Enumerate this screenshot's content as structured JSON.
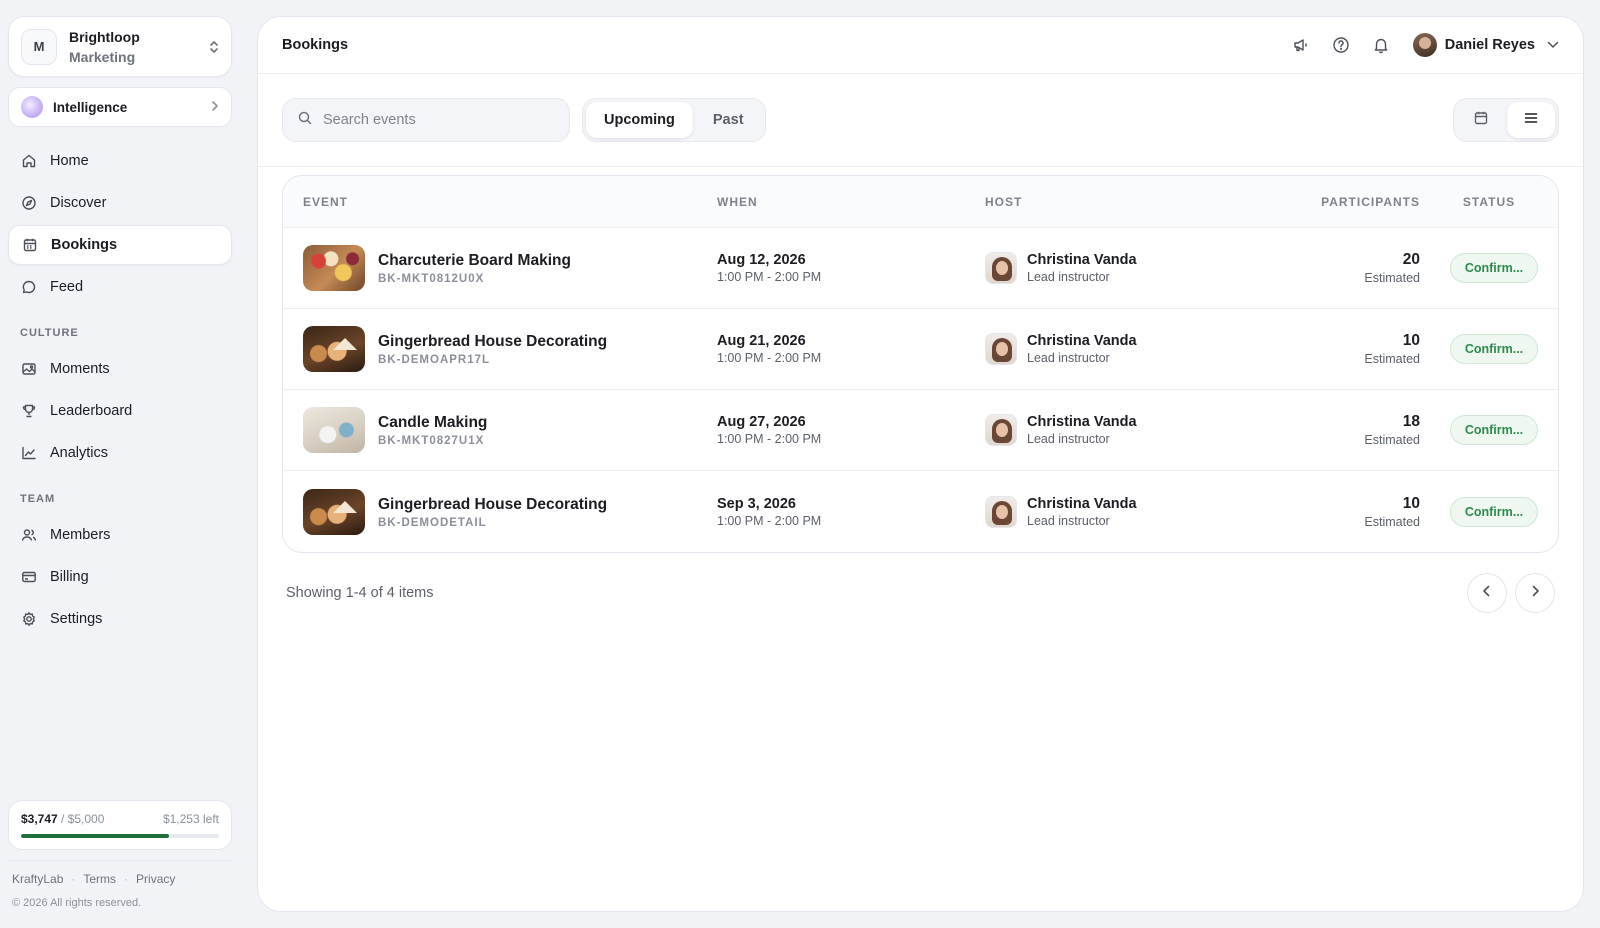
{
  "org": {
    "initial": "M",
    "name": "Brightloop",
    "sub": "Marketing"
  },
  "intelligence": {
    "label": "Intelligence"
  },
  "nav": {
    "main": [
      {
        "label": "Home",
        "icon": "home-icon"
      },
      {
        "label": "Discover",
        "icon": "compass-icon"
      },
      {
        "label": "Bookings",
        "icon": "calendar-icon",
        "active": true
      },
      {
        "label": "Feed",
        "icon": "chat-bubble-icon"
      }
    ],
    "culture_title": "CULTURE",
    "culture": [
      {
        "label": "Moments",
        "icon": "images-icon"
      },
      {
        "label": "Leaderboard",
        "icon": "trophy-icon"
      },
      {
        "label": "Analytics",
        "icon": "line-chart-icon"
      }
    ],
    "team_title": "TEAM",
    "team": [
      {
        "label": "Members",
        "icon": "users-icon"
      },
      {
        "label": "Billing",
        "icon": "credit-card-icon"
      },
      {
        "label": "Settings",
        "icon": "gear-icon"
      }
    ]
  },
  "budget": {
    "spent": "$3,747",
    "total": " / $5,000",
    "left": "$1,253 left",
    "fraction": 0.7494
  },
  "footer": {
    "brand": "KraftyLab",
    "terms": "Terms",
    "privacy": "Privacy",
    "copyright": "© 2026 All rights reserved."
  },
  "header": {
    "title": "Bookings",
    "user_name": "Daniel Reyes"
  },
  "toolbar": {
    "search_placeholder": "Search events",
    "tabs": [
      {
        "label": "Upcoming",
        "active": true
      },
      {
        "label": "Past"
      }
    ]
  },
  "table": {
    "columns": [
      "EVENT",
      "WHEN",
      "HOST",
      "PARTICIPANTS",
      "STATUS"
    ],
    "rows": [
      {
        "name": "Charcuterie Board Making",
        "code": "BK-MKT0812U0X",
        "date": "Aug 12, 2026",
        "time": "1:00 PM - 2:00 PM",
        "host": "Christina Vanda",
        "role": "Lead instructor",
        "participants": "20",
        "participants_label": "Estimated",
        "status": "Confirm...",
        "thumb": "charcuterie"
      },
      {
        "name": "Gingerbread House Decorating",
        "code": "BK-DEMOAPR17L",
        "date": "Aug 21, 2026",
        "time": "1:00 PM - 2:00 PM",
        "host": "Christina Vanda",
        "role": "Lead instructor",
        "participants": "10",
        "participants_label": "Estimated",
        "status": "Confirm...",
        "thumb": "gingerbread"
      },
      {
        "name": "Candle Making",
        "code": "BK-MKT0827U1X",
        "date": "Aug 27, 2026",
        "time": "1:00 PM - 2:00 PM",
        "host": "Christina Vanda",
        "role": "Lead instructor",
        "participants": "18",
        "participants_label": "Estimated",
        "status": "Confirm...",
        "thumb": "candle"
      },
      {
        "name": "Gingerbread House Decorating",
        "code": "BK-DEMODETAIL",
        "date": "Sep 3, 2026",
        "time": "1:00 PM - 2:00 PM",
        "host": "Christina Vanda",
        "role": "Lead instructor",
        "participants": "10",
        "participants_label": "Estimated",
        "status": "Confirm...",
        "thumb": "gingerbread"
      }
    ]
  },
  "pagination": {
    "text": "Showing 1-4 of 4 items"
  },
  "colors": {
    "accent_green": "#1f6f3a",
    "status_green": "#2f8a4d",
    "background": "#f1f3f7"
  }
}
